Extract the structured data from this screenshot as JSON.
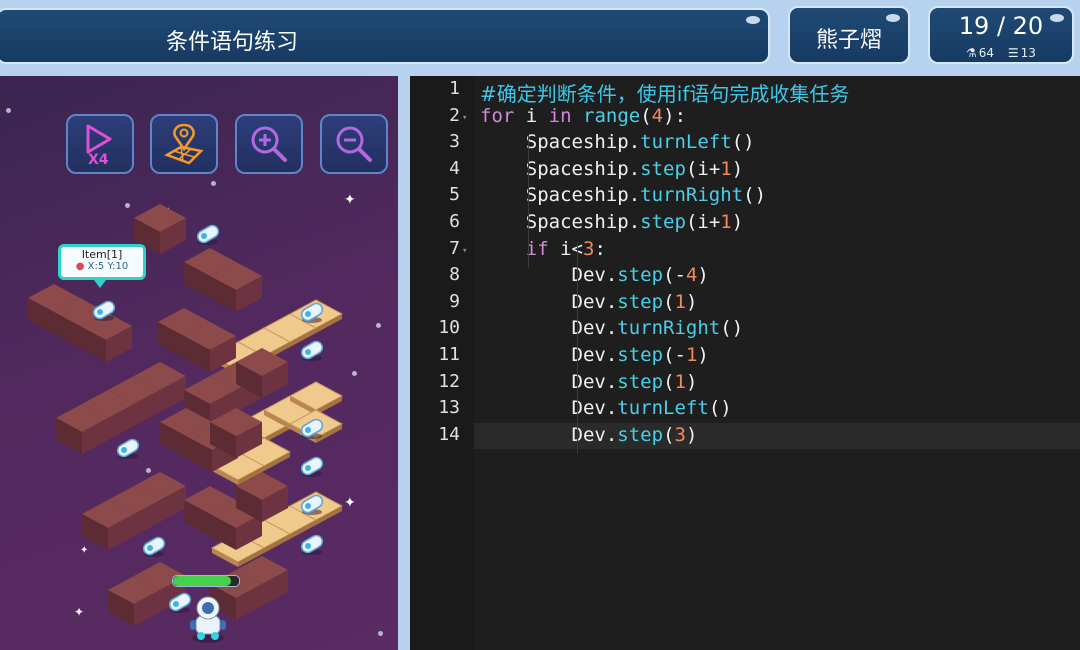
{
  "header": {
    "title": "条件语句练习",
    "player_name": "熊子熠",
    "progress": "19 / 20",
    "stat_a": "64",
    "stat_b": "13",
    "stat_a_icon": "flask-icon",
    "stat_b_icon": "list-icon"
  },
  "game": {
    "tools": [
      {
        "name": "speed-x4",
        "label": "X4",
        "icon": "play-icon"
      },
      {
        "name": "map-location",
        "icon": "map-pin-icon"
      },
      {
        "name": "zoom-in",
        "icon": "zoom-in-icon"
      },
      {
        "name": "zoom-out",
        "icon": "zoom-out-icon"
      }
    ],
    "tooltip": {
      "title": "Item[1]",
      "coords": "X:5 Y:10"
    },
    "health_fraction": 0.88
  },
  "editor": {
    "line_numbers": [
      "1",
      "2",
      "3",
      "4",
      "5",
      "6",
      "7",
      "8",
      "9",
      "10",
      "11",
      "12",
      "13",
      "14"
    ],
    "lines": [
      "#确定判断条件，使用if语句完成收集任务",
      "for i in range(4):",
      "    Spaceship.turnLeft()",
      "    Spaceship.step(i+1)",
      "    Spaceship.turnRight()",
      "    Spaceship.step(i+1)",
      "    if i<3:",
      "        Dev.step(-4)",
      "        Dev.step(1)",
      "        Dev.turnRight()",
      "        Dev.step(-1)",
      "        Dev.step(1)",
      "        Dev.turnLeft()",
      "        Dev.step(3)"
    ],
    "current_line": 14
  },
  "colors": {
    "keyword": "#d18ad8",
    "function": "#48d0e8",
    "number": "#f08a5e",
    "comment": "#3dc7e8"
  }
}
